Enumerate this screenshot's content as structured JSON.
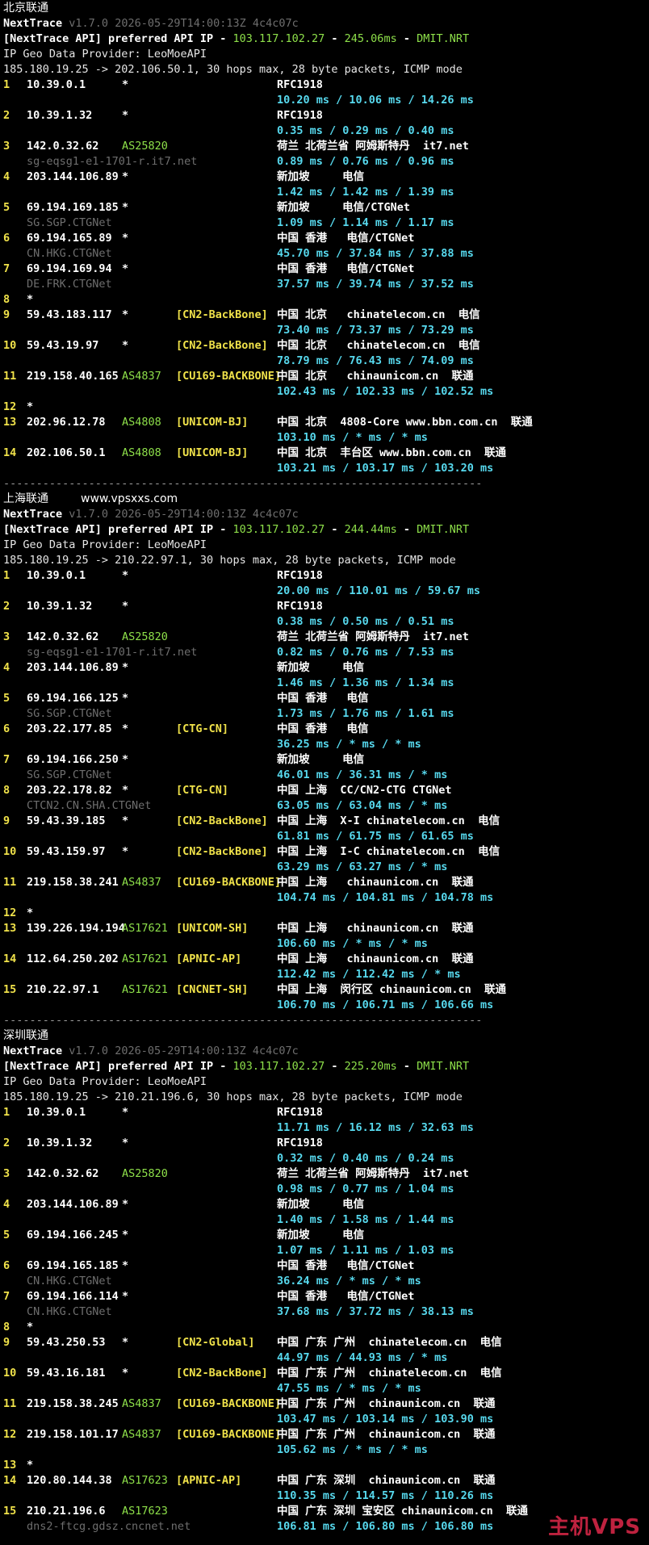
{
  "site_label": "www.vpsxxs.com",
  "watermark": "主机VPS",
  "separator": "-------------------------------------------------------------------------",
  "colors": {
    "background": "#000000",
    "green": "#8ee04a",
    "yellow": "#f0e24a",
    "cyan": "#57d9ee",
    "dim": "#6e6e6e"
  },
  "sections": [
    {
      "title": "北京联通",
      "tool": "NextTrace",
      "version": "v1.7.0 2026-05-29T14:00:13Z 4c4c07c",
      "api_prefix": "[NextTrace API] preferred API IP - ",
      "api_ip": "103.117.102.27",
      "api_latency": "245.06ms",
      "api_node": "DMIT.NRT",
      "provider": "IP Geo Data Provider: LeoMoeAPI",
      "route": "185.180.19.25 -> 202.106.50.1, 30 hops max, 28 byte packets, ICMP mode",
      "hops": [
        {
          "n": "1",
          "ip": "10.39.0.1",
          "as": "*",
          "tag": "",
          "geo": "RFC1918",
          "rtt": "10.20 ms / 10.06 ms / 14.26 ms",
          "host": ""
        },
        {
          "n": "2",
          "ip": "10.39.1.32",
          "as": "*",
          "tag": "",
          "geo": "RFC1918",
          "rtt": "0.35 ms / 0.29 ms / 0.40 ms",
          "host": ""
        },
        {
          "n": "3",
          "ip": "142.0.32.62",
          "as": "AS25820",
          "tag": "",
          "geo": "荷兰 北荷兰省 阿姆斯特丹  it7.net",
          "rtt": "0.89 ms / 0.76 ms / 0.96 ms",
          "host": "sg-eqsg1-e1-1701-r.it7.net"
        },
        {
          "n": "4",
          "ip": "203.144.106.89",
          "as": "*",
          "tag": "",
          "geo": "新加坡     电信",
          "rtt": "1.42 ms / 1.42 ms / 1.39 ms",
          "host": ""
        },
        {
          "n": "5",
          "ip": "69.194.169.185",
          "as": "*",
          "tag": "",
          "geo": "新加坡     电信/CTGNet",
          "rtt": "1.09 ms / 1.14 ms / 1.17 ms",
          "host": "SG.SGP.CTGNet"
        },
        {
          "n": "6",
          "ip": "69.194.165.89",
          "as": "*",
          "tag": "",
          "geo": "中国 香港   电信/CTGNet",
          "rtt": "45.70 ms / 37.84 ms / 37.88 ms",
          "host": "CN.HKG.CTGNet"
        },
        {
          "n": "7",
          "ip": "69.194.169.94",
          "as": "*",
          "tag": "",
          "geo": "中国 香港   电信/CTGNet",
          "rtt": "37.57 ms / 39.74 ms / 37.52 ms",
          "host": "DE.FRK.CTGNet"
        },
        {
          "n": "8",
          "ip": "*",
          "as": "",
          "tag": "",
          "geo": "",
          "rtt": "",
          "host": ""
        },
        {
          "n": "9",
          "ip": "59.43.183.117",
          "as": "*",
          "tag": "[CN2-BackBone]",
          "geo": "中国 北京   chinatelecom.cn  电信",
          "rtt": "73.40 ms / 73.37 ms / 73.29 ms",
          "host": ""
        },
        {
          "n": "10",
          "ip": "59.43.19.97",
          "as": "*",
          "tag": "[CN2-BackBone]",
          "geo": "中国 北京   chinatelecom.cn  电信",
          "rtt": "78.79 ms / 76.43 ms / 74.09 ms",
          "host": ""
        },
        {
          "n": "11",
          "ip": "219.158.40.165",
          "as": "AS4837",
          "tag": "[CU169-BACKBONE]",
          "geo": "中国 北京   chinaunicom.cn  联通",
          "rtt": "102.43 ms / 102.33 ms / 102.52 ms",
          "host": ""
        },
        {
          "n": "12",
          "ip": "*",
          "as": "",
          "tag": "",
          "geo": "",
          "rtt": "",
          "host": ""
        },
        {
          "n": "13",
          "ip": "202.96.12.78",
          "as": "AS4808",
          "tag": "[UNICOM-BJ]",
          "geo": "中国 北京  4808-Core www.bbn.com.cn  联通",
          "rtt": "103.10 ms / * ms / * ms",
          "host": ""
        },
        {
          "n": "14",
          "ip": "202.106.50.1",
          "as": "AS4808",
          "tag": "[UNICOM-BJ]",
          "geo": "中国 北京  丰台区 www.bbn.com.cn  联通",
          "rtt": "103.21 ms / 103.17 ms / 103.20 ms",
          "host": ""
        }
      ]
    },
    {
      "title": "上海联通",
      "tool": "NextTrace",
      "version": "v1.7.0 2026-05-29T14:00:13Z 4c4c07c",
      "api_prefix": "[NextTrace API] preferred API IP - ",
      "api_ip": "103.117.102.27",
      "api_latency": "244.44ms",
      "api_node": "DMIT.NRT",
      "provider": "IP Geo Data Provider: LeoMoeAPI",
      "route": "185.180.19.25 -> 210.22.97.1, 30 hops max, 28 byte packets, ICMP mode",
      "hops": [
        {
          "n": "1",
          "ip": "10.39.0.1",
          "as": "*",
          "tag": "",
          "geo": "RFC1918",
          "rtt": "20.00 ms / 110.01 ms / 59.67 ms",
          "host": ""
        },
        {
          "n": "2",
          "ip": "10.39.1.32",
          "as": "*",
          "tag": "",
          "geo": "RFC1918",
          "rtt": "0.38 ms / 0.50 ms / 0.51 ms",
          "host": ""
        },
        {
          "n": "3",
          "ip": "142.0.32.62",
          "as": "AS25820",
          "tag": "",
          "geo": "荷兰 北荷兰省 阿姆斯特丹  it7.net",
          "rtt": "0.82 ms / 0.76 ms / 7.53 ms",
          "host": "sg-eqsg1-e1-1701-r.it7.net"
        },
        {
          "n": "4",
          "ip": "203.144.106.89",
          "as": "*",
          "tag": "",
          "geo": "新加坡     电信",
          "rtt": "1.46 ms / 1.36 ms / 1.34 ms",
          "host": ""
        },
        {
          "n": "5",
          "ip": "69.194.166.125",
          "as": "*",
          "tag": "",
          "geo": "中国 香港   电信",
          "rtt": "1.73 ms / 1.76 ms / 1.61 ms",
          "host": "SG.SGP.CTGNet"
        },
        {
          "n": "6",
          "ip": "203.22.177.85",
          "as": "*",
          "tag": "[CTG-CN]",
          "geo": "中国 香港   电信",
          "rtt": "36.25 ms / * ms / * ms",
          "host": ""
        },
        {
          "n": "7",
          "ip": "69.194.166.250",
          "as": "*",
          "tag": "",
          "geo": "新加坡     电信",
          "rtt": "46.01 ms / 36.31 ms / * ms",
          "host": "SG.SGP.CTGNet"
        },
        {
          "n": "8",
          "ip": "203.22.178.82",
          "as": "*",
          "tag": "[CTG-CN]",
          "geo": "中国 上海  CC/CN2-CTG CTGNet",
          "rtt": "63.05 ms / 63.04 ms / * ms",
          "host": "CTCN2.CN.SHA.CTGNet"
        },
        {
          "n": "9",
          "ip": "59.43.39.185",
          "as": "*",
          "tag": "[CN2-BackBone]",
          "geo": "中国 上海  X-I chinatelecom.cn  电信",
          "rtt": "61.81 ms / 61.75 ms / 61.65 ms",
          "host": ""
        },
        {
          "n": "10",
          "ip": "59.43.159.97",
          "as": "*",
          "tag": "[CN2-BackBone]",
          "geo": "中国 上海  I-C chinatelecom.cn  电信",
          "rtt": "63.29 ms / 63.27 ms / * ms",
          "host": ""
        },
        {
          "n": "11",
          "ip": "219.158.38.241",
          "as": "AS4837",
          "tag": "[CU169-BACKBONE]",
          "geo": "中国 上海   chinaunicom.cn  联通",
          "rtt": "104.74 ms / 104.81 ms / 104.78 ms",
          "host": ""
        },
        {
          "n": "12",
          "ip": "*",
          "as": "",
          "tag": "",
          "geo": "",
          "rtt": "",
          "host": ""
        },
        {
          "n": "13",
          "ip": "139.226.194.194",
          "as": "AS17621",
          "tag": "[UNICOM-SH]",
          "geo": "中国 上海   chinaunicom.cn  联通",
          "rtt": "106.60 ms / * ms / * ms",
          "host": ""
        },
        {
          "n": "14",
          "ip": "112.64.250.202",
          "as": "AS17621",
          "tag": "[APNIC-AP]",
          "geo": "中国 上海   chinaunicom.cn  联通",
          "rtt": "112.42 ms / 112.42 ms / * ms",
          "host": ""
        },
        {
          "n": "15",
          "ip": "210.22.97.1",
          "as": "AS17621",
          "tag": "[CNCNET-SH]",
          "geo": "中国 上海  闵行区 chinaunicom.cn  联通",
          "rtt": "106.70 ms / 106.71 ms / 106.66 ms",
          "host": ""
        }
      ]
    },
    {
      "title": "深圳联通",
      "tool": "NextTrace",
      "version": "v1.7.0 2026-05-29T14:00:13Z 4c4c07c",
      "api_prefix": "[NextTrace API] preferred API IP - ",
      "api_ip": "103.117.102.27",
      "api_latency": "225.20ms",
      "api_node": "DMIT.NRT",
      "provider": "IP Geo Data Provider: LeoMoeAPI",
      "route": "185.180.19.25 -> 210.21.196.6, 30 hops max, 28 byte packets, ICMP mode",
      "hops": [
        {
          "n": "1",
          "ip": "10.39.0.1",
          "as": "*",
          "tag": "",
          "geo": "RFC1918",
          "rtt": "11.71 ms / 16.12 ms / 32.63 ms",
          "host": ""
        },
        {
          "n": "2",
          "ip": "10.39.1.32",
          "as": "*",
          "tag": "",
          "geo": "RFC1918",
          "rtt": "0.32 ms / 0.40 ms / 0.24 ms",
          "host": ""
        },
        {
          "n": "3",
          "ip": "142.0.32.62",
          "as": "AS25820",
          "tag": "",
          "geo": "荷兰 北荷兰省 阿姆斯特丹  it7.net",
          "rtt": "0.98 ms / 0.77 ms / 1.04 ms",
          "host": ""
        },
        {
          "n": "4",
          "ip": "203.144.106.89",
          "as": "*",
          "tag": "",
          "geo": "新加坡     电信",
          "rtt": "1.40 ms / 1.58 ms / 1.44 ms",
          "host": ""
        },
        {
          "n": "5",
          "ip": "69.194.166.245",
          "as": "*",
          "tag": "",
          "geo": "新加坡     电信",
          "rtt": "1.07 ms / 1.11 ms / 1.03 ms",
          "host": ""
        },
        {
          "n": "6",
          "ip": "69.194.165.185",
          "as": "*",
          "tag": "",
          "geo": "中国 香港   电信/CTGNet",
          "rtt": "36.24 ms / * ms / * ms",
          "host": "CN.HKG.CTGNet"
        },
        {
          "n": "7",
          "ip": "69.194.166.114",
          "as": "*",
          "tag": "",
          "geo": "中国 香港   电信/CTGNet",
          "rtt": "37.68 ms / 37.72 ms / 38.13 ms",
          "host": "CN.HKG.CTGNet"
        },
        {
          "n": "8",
          "ip": "*",
          "as": "",
          "tag": "",
          "geo": "",
          "rtt": "",
          "host": ""
        },
        {
          "n": "9",
          "ip": "59.43.250.53",
          "as": "*",
          "tag": "[CN2-Global]",
          "geo": "中国 广东 广州  chinatelecom.cn  电信",
          "rtt": "44.97 ms / 44.93 ms / * ms",
          "host": ""
        },
        {
          "n": "10",
          "ip": "59.43.16.181",
          "as": "*",
          "tag": "[CN2-BackBone]",
          "geo": "中国 广东 广州  chinatelecom.cn  电信",
          "rtt": "47.55 ms / * ms / * ms",
          "host": ""
        },
        {
          "n": "11",
          "ip": "219.158.38.245",
          "as": "AS4837",
          "tag": "[CU169-BACKBONE]",
          "geo": "中国 广东 广州  chinaunicom.cn  联通",
          "rtt": "103.47 ms / 103.14 ms / 103.90 ms",
          "host": ""
        },
        {
          "n": "12",
          "ip": "219.158.101.17",
          "as": "AS4837",
          "tag": "[CU169-BACKBONE]",
          "geo": "中国 广东 广州  chinaunicom.cn  联通",
          "rtt": "105.62 ms / * ms / * ms",
          "host": ""
        },
        {
          "n": "13",
          "ip": "*",
          "as": "",
          "tag": "",
          "geo": "",
          "rtt": "",
          "host": ""
        },
        {
          "n": "14",
          "ip": "120.80.144.38",
          "as": "AS17623",
          "tag": "[APNIC-AP]",
          "geo": "中国 广东 深圳  chinaunicom.cn  联通",
          "rtt": "110.35 ms / 114.57 ms / 110.26 ms",
          "host": ""
        },
        {
          "n": "15",
          "ip": "210.21.196.6",
          "as": "AS17623",
          "tag": "",
          "geo": "中国 广东 深圳 宝安区 chinaunicom.cn  联通",
          "rtt": "106.81 ms / 106.80 ms / 106.80 ms",
          "host": "dns2-ftcg.gdsz.cncnet.net"
        }
      ]
    }
  ]
}
